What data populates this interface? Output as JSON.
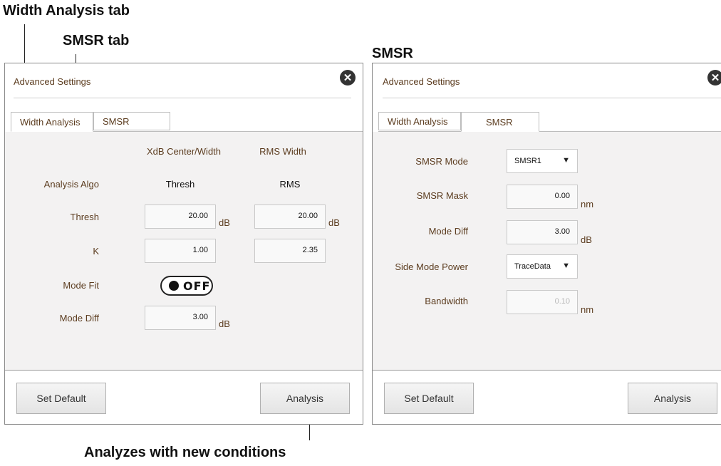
{
  "callouts": {
    "width_analysis_tab": "Width Analysis tab",
    "smsr_tab": "SMSR tab",
    "smsr_heading": "SMSR",
    "analyzes": "Analyzes with new conditions"
  },
  "left_panel": {
    "title": "Advanced Settings",
    "tabs": [
      "Width Analysis",
      "SMSR"
    ],
    "column_headers": [
      "XdB Center/Width",
      "RMS Width"
    ],
    "rows": {
      "analysis_algo": {
        "label": "Analysis Algo",
        "values": [
          "Thresh",
          "RMS"
        ]
      },
      "thresh": {
        "label": "Thresh",
        "values": [
          "20.00",
          "20.00"
        ],
        "unit": "dB"
      },
      "k": {
        "label": "K",
        "values": [
          "1.00",
          "2.35"
        ]
      },
      "mode_fit": {
        "label": "Mode Fit",
        "toggle": "OFF"
      },
      "mode_diff": {
        "label": "Mode Diff",
        "value": "3.00",
        "unit": "dB"
      }
    },
    "buttons": {
      "set_default": "Set Default",
      "analysis": "Analysis"
    }
  },
  "right_panel": {
    "title": "Advanced Settings",
    "tabs": [
      "Width Analysis",
      "SMSR"
    ],
    "rows": {
      "smsr_mode": {
        "label": "SMSR Mode",
        "value": "SMSR1"
      },
      "smsr_mask": {
        "label": "SMSR Mask",
        "value": "0.00",
        "unit": "nm"
      },
      "mode_diff": {
        "label": "Mode Diff",
        "value": "3.00",
        "unit": "dB"
      },
      "side_mode_power": {
        "label": "Side Mode Power",
        "value": "TraceData"
      },
      "bandwidth": {
        "label": "Bandwidth",
        "value": "0.10",
        "unit": "nm"
      }
    },
    "buttons": {
      "set_default": "Set Default",
      "analysis": "Analysis"
    }
  },
  "colors": {
    "label_text": "#5c3d20",
    "content_bg": "#f3f2f2",
    "border": "#8a8a8a"
  },
  "icons": {
    "close": "close-circle-icon",
    "dropdown": "caret-down-icon"
  }
}
